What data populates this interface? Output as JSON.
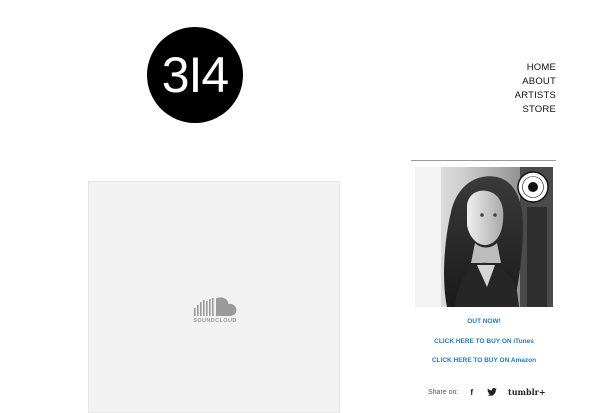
{
  "logo": {
    "text": "3I4"
  },
  "nav": {
    "items": [
      "HOME",
      "ABOUT",
      "ARTISTS",
      "STORE"
    ]
  },
  "player": {
    "brand": "SOUNDCLOUD"
  },
  "sidebar": {
    "out_now": "OUT NOW!",
    "itunes_link": "CLICK HERE TO BUY ON iTunes",
    "amazon_link": "CLICK HERE TO BUY ON Amazon"
  },
  "share": {
    "label": "Share on:",
    "facebook": "f",
    "tumblr": "tumblr+"
  },
  "colors": {
    "link": "#1f7bc1",
    "logo_bg": "#000000"
  }
}
